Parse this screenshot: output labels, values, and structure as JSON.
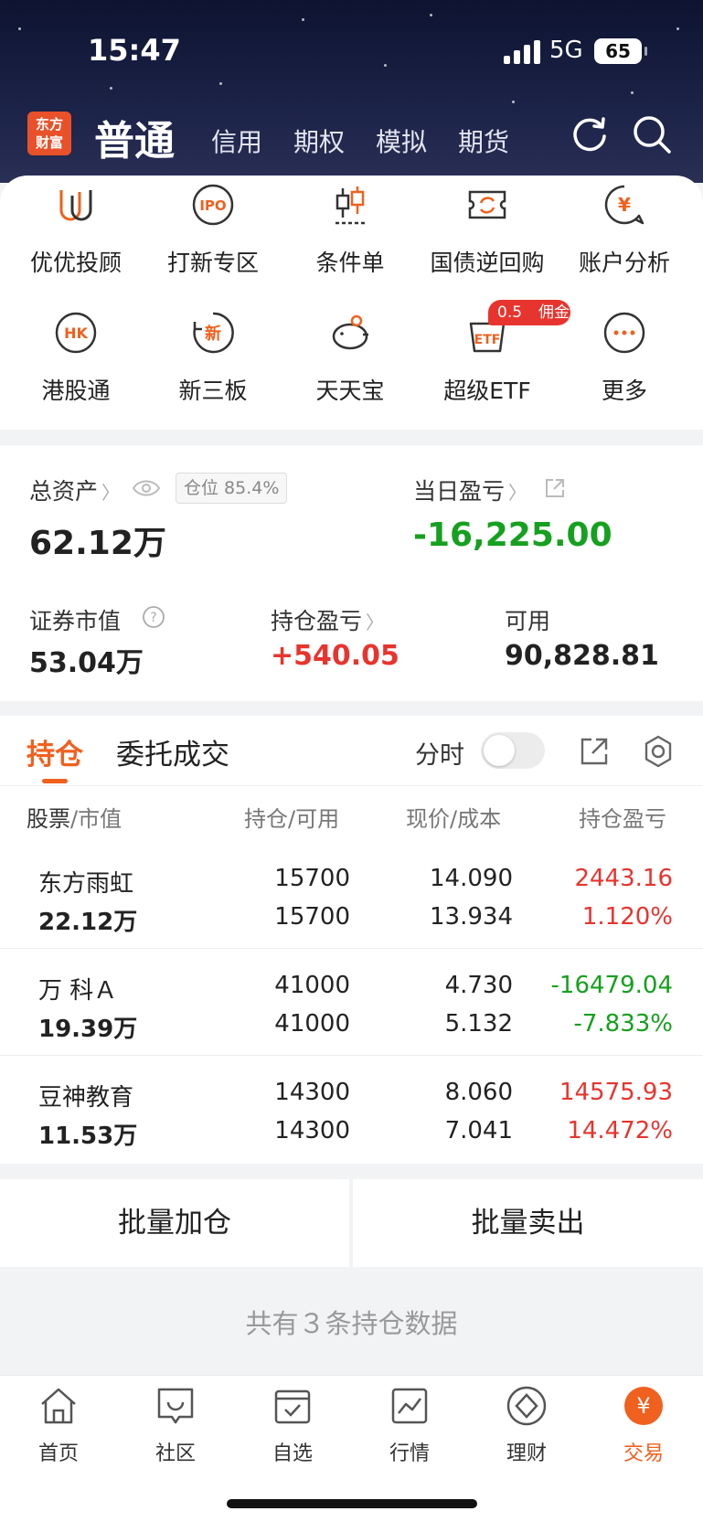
{
  "status": {
    "time": "15:47",
    "network": "5G",
    "battery": "65"
  },
  "header": {
    "logo": [
      "东方",
      "财富"
    ],
    "active_tab": "普通",
    "tabs": [
      "信用",
      "期权",
      "模拟",
      "期货"
    ]
  },
  "quick_menu": [
    {
      "label": "优优投顾",
      "icon": "uu-icon"
    },
    {
      "label": "打新专区",
      "icon": "ipo-icon"
    },
    {
      "label": "条件单",
      "icon": "candlestick-icon"
    },
    {
      "label": "国债逆回购",
      "icon": "repo-ticket-icon"
    },
    {
      "label": "账户分析",
      "icon": "yen-chat-icon"
    },
    {
      "label": "港股通",
      "icon": "hk-icon"
    },
    {
      "label": "新三板",
      "icon": "xin-icon"
    },
    {
      "label": "天天宝",
      "icon": "piggy-bank-icon"
    },
    {
      "label": "超级ETF",
      "icon": "etf-icon"
    },
    {
      "label": "更多",
      "icon": "more-dots-icon"
    }
  ],
  "etf_badge": {
    "value": "0.5",
    "text": "佣金"
  },
  "assets": {
    "total_label": "总资产",
    "total_value": "62.12万",
    "position_ratio": "仓位 85.4%",
    "daily_pl_label": "当日盈亏",
    "daily_pl_value": "-16,225.00",
    "market_value_label": "证券市值",
    "market_value": "53.04万",
    "holding_pl_label": "持仓盈亏",
    "holding_pl_value": "+540.05",
    "available_label": "可用",
    "available_value": "90,828.81"
  },
  "holdings": {
    "active_tab": "持仓",
    "tab2": "委托成交",
    "fenshi_label": "分时",
    "columns": {
      "stock": "股票",
      "stock_sub": "/市值",
      "position": "持仓",
      "position_sub": "/可用",
      "price": "现价",
      "price_sub": "/成本",
      "pl": "持仓盈亏"
    },
    "rows": [
      {
        "name": "东方雨虹",
        "mv": "22.12万",
        "pos": "15700",
        "avail": "15700",
        "price": "14.090",
        "cost": "13.934",
        "pl": "2443.16",
        "plpct": "1.120%",
        "dir": "up"
      },
      {
        "name": "万 科Ａ",
        "mv": "19.39万",
        "pos": "41000",
        "avail": "41000",
        "price": "4.730",
        "cost": "5.132",
        "pl": "-16479.04",
        "plpct": "-7.833%",
        "dir": "down"
      },
      {
        "name": "豆神教育",
        "mv": "11.53万",
        "pos": "14300",
        "avail": "14300",
        "price": "8.060",
        "cost": "7.041",
        "pl": "14575.93",
        "plpct": "14.472%",
        "dir": "up"
      }
    ]
  },
  "buttons": {
    "batch_add": "批量加仓",
    "batch_sell": "批量卖出"
  },
  "footnote": "共有３条持仓数据",
  "nav": [
    {
      "label": "首页",
      "icon": "home-icon"
    },
    {
      "label": "社区",
      "icon": "community-icon"
    },
    {
      "label": "自选",
      "icon": "watchlist-icon"
    },
    {
      "label": "行情",
      "icon": "market-icon"
    },
    {
      "label": "理财",
      "icon": "wealth-icon"
    },
    {
      "label": "交易",
      "icon": "trade-icon"
    }
  ],
  "colors": {
    "accent": "#f0601e",
    "up": "#e8342e",
    "down": "#16a01f"
  }
}
